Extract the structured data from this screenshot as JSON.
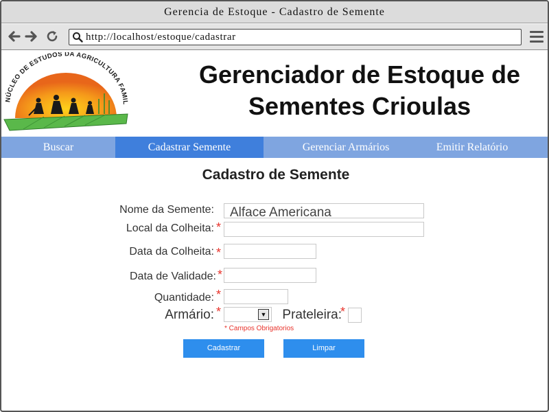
{
  "window": {
    "title": "Gerencia de Estoque - Cadastro de Semente"
  },
  "browser": {
    "url": "http://localhost/estoque/cadastrar",
    "back_icon": "arrow-left-icon",
    "forward_icon": "arrow-right-icon",
    "reload_icon": "reload-icon",
    "search_icon": "search-icon",
    "menu_icon": "hamburger-menu-icon"
  },
  "header": {
    "logo_text": "NÚCLEO DE ESTUDOS DA AGRICULTURA FAMILIAR",
    "title_line1": "Gerenciador de Estoque de",
    "title_line2": "Sementes Crioulas"
  },
  "nav": {
    "items": [
      {
        "label": "Buscar",
        "active": false
      },
      {
        "label": "Cadastrar Semente",
        "active": true
      },
      {
        "label": "Gerenciar Armários",
        "active": false
      },
      {
        "label": "Emitir Relatório",
        "active": false
      }
    ]
  },
  "form": {
    "title": "Cadastro de Semente",
    "required_mark": "*",
    "fields": {
      "nome": {
        "label": "Nome da Semente:",
        "value": "Alface Americana"
      },
      "local": {
        "label": "Local da Colheita:",
        "value": ""
      },
      "data_colheita": {
        "label": "Data da Colheita:",
        "value": ""
      },
      "data_validade": {
        "label": "Data de Validade:",
        "value": ""
      },
      "quantidade": {
        "label": "Quantidade:",
        "value": ""
      },
      "armario": {
        "label": "Armário:",
        "value": ""
      },
      "prateleira": {
        "label": "Prateleira:",
        "value": ""
      }
    },
    "required_note": "* Campos Obrigatorios",
    "submit_label": "Cadastrar",
    "clear_label": "Limpar"
  },
  "colors": {
    "nav_bg": "#7fa5e0",
    "nav_active": "#3f7fdc",
    "button": "#2e8eed",
    "required": "#e8332b"
  }
}
